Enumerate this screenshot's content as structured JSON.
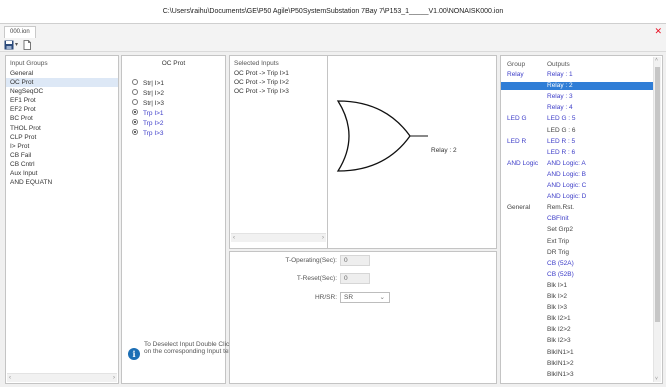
{
  "window": {
    "title": "C:\\Users\\raihu\\Documents\\GE\\P50 Agile\\P50SystemSubstation 7Bay 7\\P153_1_____V1.00\\NONAISK000.ion"
  },
  "tabs": [
    {
      "label": "000.ion"
    }
  ],
  "input_groups": {
    "header": "Input Groups",
    "items": [
      "General",
      "OC Prot",
      "NegSeqOC",
      "EF1 Prot",
      "EF2 Prot",
      "BC Prot",
      "THOL Prot",
      "CLP Prot",
      "I> Prot",
      "CB Fail",
      "CB Cntrl",
      "Aux Input",
      "AND EQUATN"
    ],
    "selected": "OC Prot"
  },
  "oc_prot": {
    "title": "OC Prot",
    "options": [
      {
        "label": "Str| I>1",
        "checked": false
      },
      {
        "label": "Str| I>2",
        "checked": false
      },
      {
        "label": "Str| I>3",
        "checked": false
      },
      {
        "label": "Trp I>1",
        "checked": true
      },
      {
        "label": "Trp I>2",
        "checked": true
      },
      {
        "label": "Trp I>3",
        "checked": true
      }
    ],
    "info_text": "To Deselect Input Double Click on the corresponding Input text"
  },
  "selected_inputs": {
    "header": "Selected Inputs",
    "items": [
      "OC Prot -> Trip I>1",
      "OC Prot -> Trip I>2",
      "OC Prot -> Trip I>3"
    ]
  },
  "gate": {
    "output_label": "Relay : 2"
  },
  "params": {
    "t_operating_label": "T-Operating(Sec):",
    "t_operating_value": "0",
    "t_reset_label": "T-Reset(Sec):",
    "t_reset_value": "0",
    "hr_sr_label": "HR/SR:",
    "hr_sr_value": "SR"
  },
  "outputs": {
    "group_header": "Group",
    "outputs_header": "Outputs",
    "rows": [
      {
        "group": "Relay",
        "value": "Relay : 1",
        "style": "blue"
      },
      {
        "group": "",
        "value": "Relay : 2",
        "style": "blue",
        "selected": true
      },
      {
        "group": "",
        "value": "Relay : 3",
        "style": "blue"
      },
      {
        "group": "",
        "value": "Relay : 4",
        "style": "blue"
      },
      {
        "group": "LED G",
        "value": "LED G : 5",
        "style": "blue"
      },
      {
        "group": "",
        "value": "LED G : 6",
        "style": "dark"
      },
      {
        "group": "LED R",
        "value": "LED R : 5",
        "style": "blue"
      },
      {
        "group": "",
        "value": "LED R : 6",
        "style": "blue"
      },
      {
        "group": "AND Logic",
        "value": "AND Logic: A",
        "style": "blue"
      },
      {
        "group": "",
        "value": "AND Logic: B",
        "style": "blue"
      },
      {
        "group": "",
        "value": "AND Logic: C",
        "style": "blue"
      },
      {
        "group": "",
        "value": "AND Logic: D",
        "style": "blue"
      },
      {
        "group": "General",
        "value": "Rem.Rst.",
        "style": "dark",
        "group_plain": true
      },
      {
        "group": "",
        "value": "CBFInit",
        "style": "blue"
      },
      {
        "group": "",
        "value": "Set Grp2",
        "style": "dark"
      },
      {
        "group": "",
        "value": "Ext Trip",
        "style": "dark"
      },
      {
        "group": "",
        "value": "DR Trig",
        "style": "dark"
      },
      {
        "group": "",
        "value": "CB (52A)",
        "style": "blue"
      },
      {
        "group": "",
        "value": "CB (52B)",
        "style": "blue"
      },
      {
        "group": "",
        "value": "Blk I>1",
        "style": "dark"
      },
      {
        "group": "",
        "value": "Blk I>2",
        "style": "dark"
      },
      {
        "group": "",
        "value": "Blk I>3",
        "style": "dark"
      },
      {
        "group": "",
        "value": "Blk I2>1",
        "style": "dark"
      },
      {
        "group": "",
        "value": "Blk I2>2",
        "style": "dark"
      },
      {
        "group": "",
        "value": "Blk I2>3",
        "style": "dark"
      },
      {
        "group": "",
        "value": "BlkIN1>1",
        "style": "dark"
      },
      {
        "group": "",
        "value": "BlkIN1>2",
        "style": "dark"
      },
      {
        "group": "",
        "value": "BlkIN1>3",
        "style": "dark"
      }
    ]
  }
}
